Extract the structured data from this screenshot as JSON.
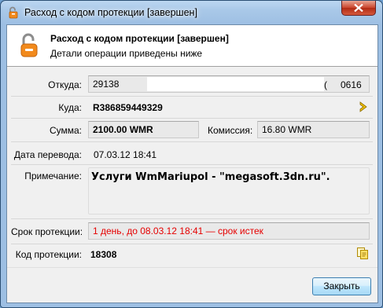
{
  "window": {
    "title": "Расход с кодом протекции [завершен]"
  },
  "header": {
    "title": "Расход с кодом протекции [завершен]",
    "subtitle": "Детали операции приведены ниже",
    "icon": "unlocked-padlock-icon"
  },
  "form": {
    "from_label": "Откуда:",
    "from_value_start": "29138",
    "from_value_mid": "(",
    "from_value_end": "0616",
    "to_label": "Куда:",
    "to_value": "R386859449329",
    "sum_label": "Сумма:",
    "sum_value": "2100.00 WMR",
    "fee_label": "Комиссия:",
    "fee_value": "16.80 WMR",
    "date_label": "Дата перевода:",
    "date_value": "07.03.12 18:41",
    "note_label": "Примечание:",
    "note_value": "Услуги WmMariupol - \"megasoft.3dn.ru\".",
    "protection_term_label": "Срок протекции:",
    "protection_term_value": "1 день, до 08.03.12 18:41 — срок истек",
    "protection_code_label": "Код протекции:",
    "protection_code_value": "18308"
  },
  "buttons": {
    "close_label": "Закрыть"
  },
  "colors": {
    "expired_text": "#e60000",
    "lock_orange": "#f28a1c"
  }
}
